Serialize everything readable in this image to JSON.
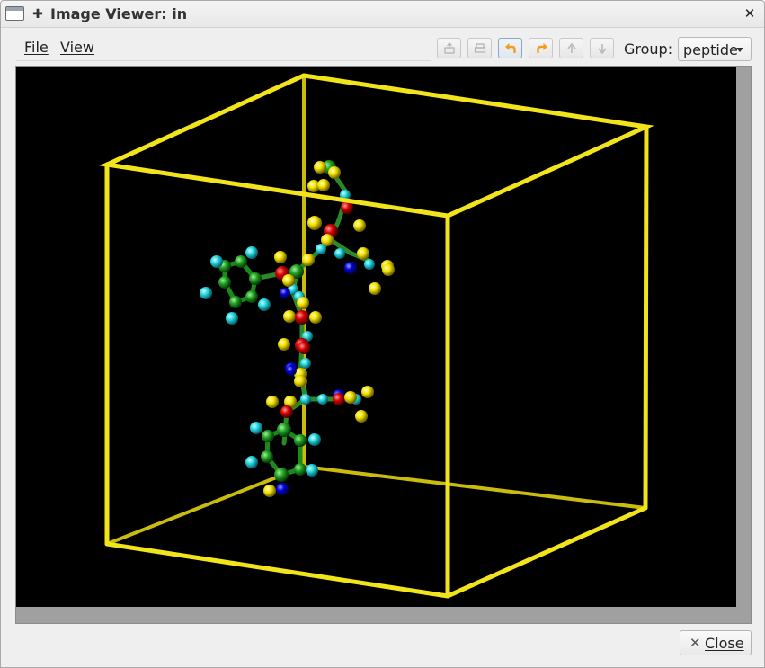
{
  "window": {
    "title": "Image Viewer: in",
    "close_glyph": "✕",
    "pin_glyph": "✚"
  },
  "menu": {
    "file": "File",
    "view": "View"
  },
  "toolbar": {
    "buttons": [
      {
        "name": "export-icon"
      },
      {
        "name": "print-icon"
      },
      {
        "name": "undo-arrow-icon",
        "color": "#f29c1f"
      },
      {
        "name": "redo-arrow-icon",
        "color": "#f29c1f"
      },
      {
        "name": "up-arrow-icon"
      },
      {
        "name": "down-arrow-icon"
      }
    ],
    "group_label": "Group:",
    "group_value": "peptide"
  },
  "viewer": {
    "background": "#000000",
    "box_color": "#f2e41a",
    "atom_colors": {
      "carbon": "#1f8f1f",
      "hydrogen": "#f4e300",
      "oxygen": "#d30000",
      "nitrogen": "#0000d8",
      "aromatic_h": "#24d6e0"
    }
  },
  "footer": {
    "close_label": "Close",
    "close_glyph": "✕"
  }
}
